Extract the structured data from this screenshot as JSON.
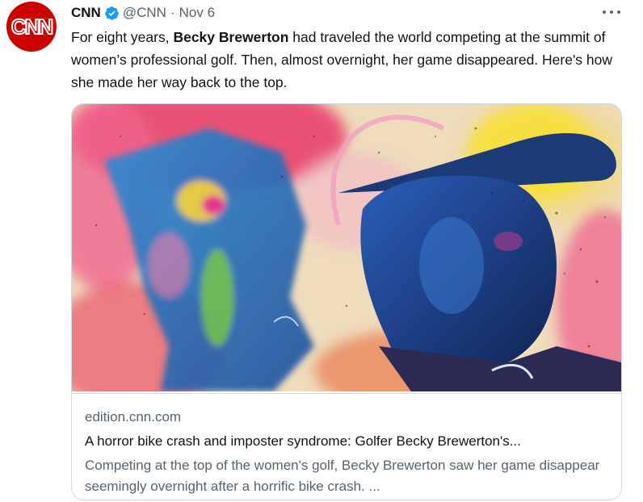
{
  "tweet": {
    "avatar_text": "CNN",
    "author_name": "CNN",
    "verified_icon": "verified-badge-icon",
    "handle": "@CNN",
    "separator": "·",
    "date": "Nov 6",
    "more_icon": "more-horizontal-icon",
    "text_before": "For eight years, ",
    "text_bold": "Becky Brewerton",
    "text_after": " had traveled the world competing at the summit of women’s professional golf. Then, almost overnight, her game disappeared. Here's how she made her way back to the top."
  },
  "card": {
    "domain": "edition.cnn.com",
    "title": "A horror bike crash and imposter syndrome: Golfer Becky Brewerton's...",
    "description": "Competing at the top of the women's golf, Becky Brewerton saw her game disappear seemingly overnight after a horrific bike crash. ...",
    "image_description": "colorful-painted-portrait-golfer-image"
  },
  "colors": {
    "cnn_red": "#cc0000",
    "verified_blue": "#1d9bf0",
    "secondary_text": "#536471",
    "border": "#cfd9de"
  }
}
